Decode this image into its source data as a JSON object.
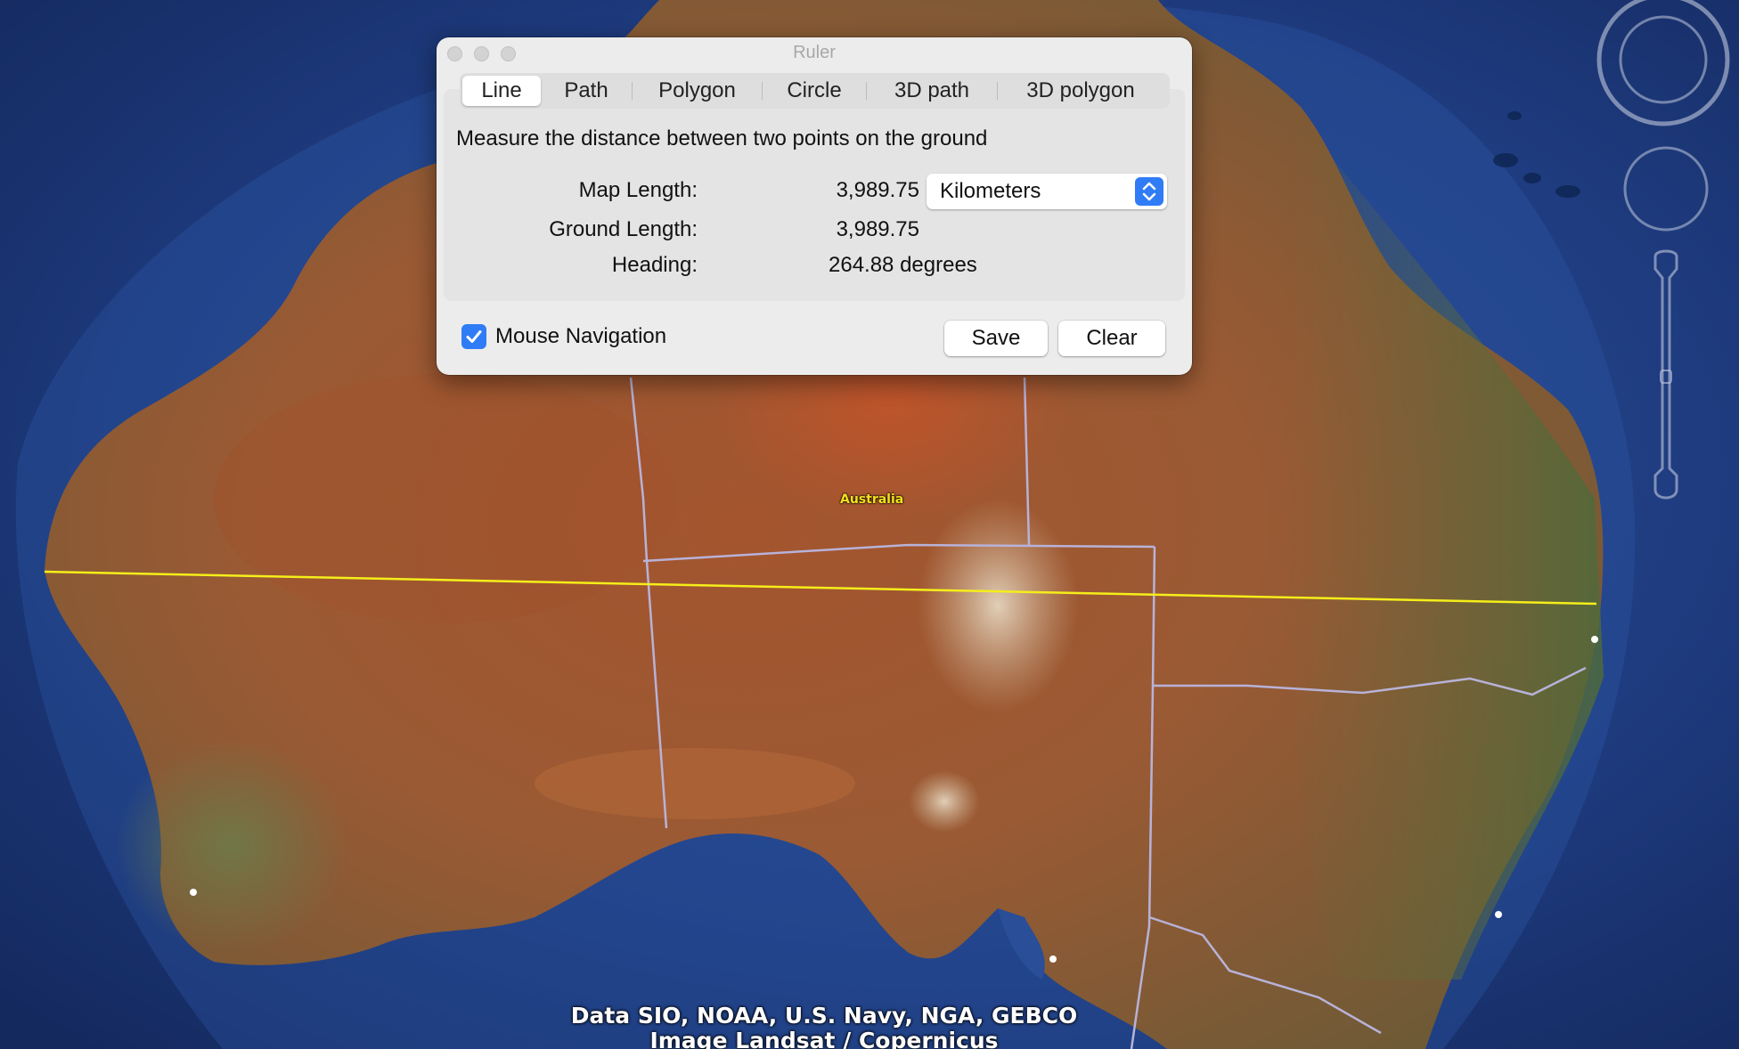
{
  "map": {
    "place_label": "Australia",
    "attribution_line1": "Data SIO, NOAA, U.S. Navy, NGA, GEBCO",
    "attribution_line2": "Image Landsat / Copernicus",
    "ruler_line_color": "#f5ee1a",
    "border_color": "#b8b2d8"
  },
  "ruler": {
    "title": "Ruler",
    "tabs": [
      {
        "label": "Line",
        "active": true
      },
      {
        "label": "Path",
        "active": false
      },
      {
        "label": "Polygon",
        "active": false
      },
      {
        "label": "Circle",
        "active": false
      },
      {
        "label": "3D path",
        "active": false
      },
      {
        "label": "3D polygon",
        "active": false
      }
    ],
    "description": "Measure the distance between two points on the ground",
    "map_length_label": "Map Length:",
    "map_length_value": "3,989.75",
    "unit_selected": "Kilometers",
    "ground_length_label": "Ground Length:",
    "ground_length_value": "3,989.75",
    "heading_label": "Heading:",
    "heading_value": "264.88 degrees",
    "mouse_navigation_label": "Mouse Navigation",
    "mouse_navigation_checked": true,
    "save_label": "Save",
    "clear_label": "Clear"
  }
}
